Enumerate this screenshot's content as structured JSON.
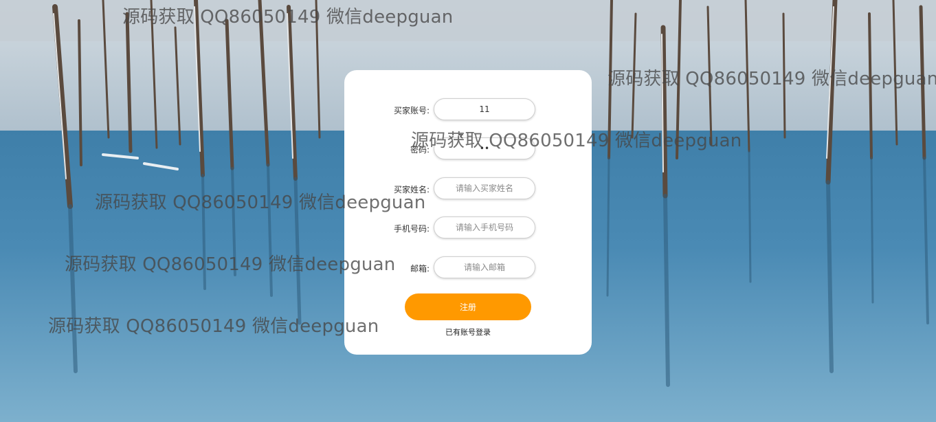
{
  "form": {
    "account_label": "买家账号:",
    "account_value": "11",
    "password_label": "密码:",
    "password_value": "••",
    "name_label": "买家姓名:",
    "name_placeholder": "请输入买家姓名",
    "phone_label": "手机号码:",
    "phone_placeholder": "请输入手机号码",
    "email_label": "邮箱:",
    "email_placeholder": "请输入邮箱",
    "register_label": "注册",
    "login_link": "已有账号登录"
  },
  "watermarks": [
    "源码获取 QQ86050149 微信deepguan",
    "源码获取 QQ86050149 微信deepguan",
    "源码获取 QQ86050149 微信deepguan",
    "源码获取 QQ86050149 微信deepguan",
    "源码获取 QQ86050149 微信deepguan",
    "源码获取 QQ86050149 微信deepguan"
  ],
  "colors": {
    "accent": "#ff9900",
    "card": "#ffffff",
    "water": "#4f8cb3"
  },
  "icons": {
    "text_cursor": "i-beam-cursor-icon"
  }
}
